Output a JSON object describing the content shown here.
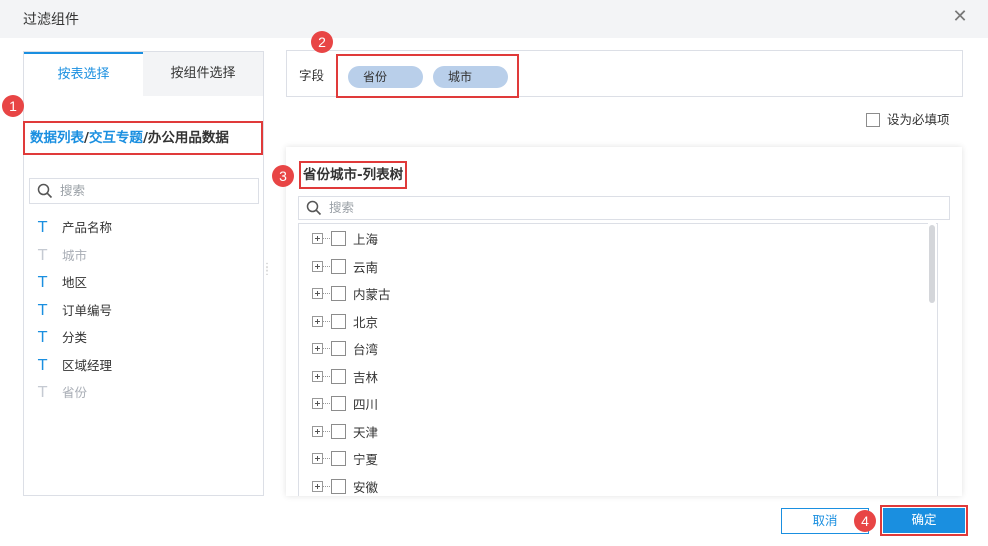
{
  "dialog": {
    "title": "过滤组件",
    "close_icon": "close-icon"
  },
  "left_panel": {
    "tabs": [
      {
        "label": "按表选择",
        "active": true
      },
      {
        "label": "按组件选择",
        "active": false
      }
    ],
    "breadcrumb": {
      "parts": [
        "数据列表",
        "交互专题",
        "办公用品数据"
      ],
      "separator": "/"
    },
    "search": {
      "placeholder": "搜索"
    },
    "fields": [
      {
        "name": "产品名称",
        "enabled": true
      },
      {
        "name": "城市",
        "enabled": false
      },
      {
        "name": "地区",
        "enabled": true
      },
      {
        "name": "订单编号",
        "enabled": true
      },
      {
        "name": "分类",
        "enabled": true
      },
      {
        "name": "区域经理",
        "enabled": true
      },
      {
        "name": "省份",
        "enabled": false
      }
    ]
  },
  "field_bar": {
    "label": "字段",
    "chips": [
      "省份",
      "城市"
    ]
  },
  "required_option": {
    "label": "设为必填项",
    "checked": false
  },
  "tree_panel": {
    "title": "省份城市-列表树",
    "search": {
      "placeholder": "搜索"
    },
    "items": [
      "上海",
      "云南",
      "内蒙古",
      "北京",
      "台湾",
      "吉林",
      "四川",
      "天津",
      "宁夏",
      "安徽"
    ]
  },
  "buttons": {
    "cancel": "取消",
    "ok": "确定"
  },
  "annotations": [
    "1",
    "2",
    "3",
    "4"
  ],
  "colors": {
    "accent": "#1a8fe0",
    "highlight_frame": "#e03a3a",
    "badge": "#e84545",
    "chip": "#b9cfea"
  }
}
